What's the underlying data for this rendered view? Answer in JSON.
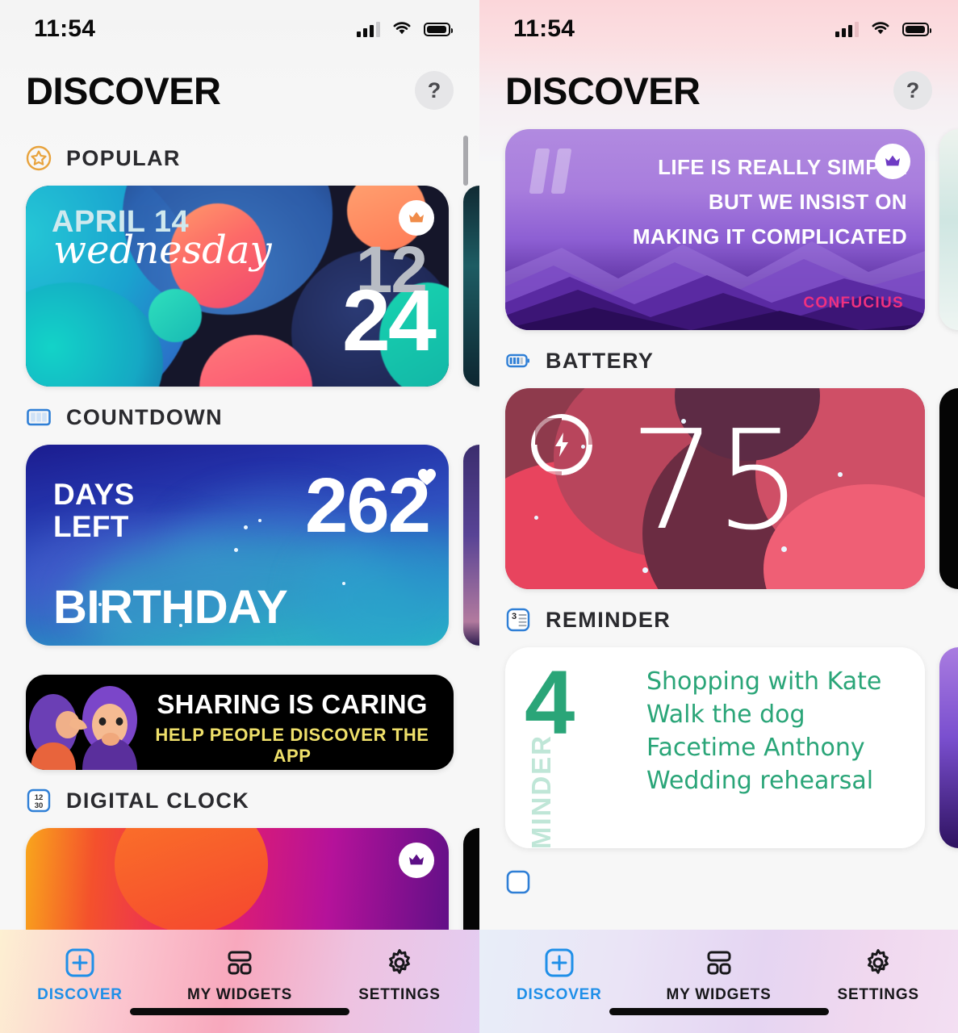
{
  "app": {
    "accent_blue": "#1f8fe8",
    "accent_orange": "#e8a33d",
    "accent_green": "#2aa578",
    "accent_pink": "#f0317f"
  },
  "panels": [
    {
      "id": "left",
      "status": {
        "time": "11:54",
        "signal_icon": "cellular-bars-icon",
        "wifi_icon": "wifi-icon",
        "battery_icon": "battery-icon"
      },
      "header": {
        "title": "DISCOVER",
        "help_label": "?"
      },
      "sections": [
        {
          "label": "POPULAR",
          "icon": "star-badge-icon",
          "widget": {
            "kind": "gradient-clock",
            "date": "APRIL 14",
            "weekday": "wednesday",
            "hour": "12",
            "minute": "24",
            "premium_badge": "crown-icon"
          }
        },
        {
          "label": "COUNTDOWN",
          "icon": "grid-columns-icon",
          "widget": {
            "kind": "countdown",
            "label_line1": "DAYS",
            "label_line2": "LEFT",
            "number": "262",
            "title": "BIRTHDAY"
          }
        }
      ],
      "promo": {
        "headline": "SHARING IS CARING",
        "subline": "HELP PEOPLE DISCOVER THE APP",
        "art": "two-women-whispering-illustration"
      },
      "trailing_section": {
        "label": "DIGITAL CLOCK",
        "icon": "clock-1230-icon"
      },
      "tabs": [
        {
          "label": "DISCOVER",
          "icon": "plus-square-icon",
          "active": true
        },
        {
          "label": "MY WIDGETS",
          "icon": "widgets-grid-icon",
          "active": false
        },
        {
          "label": "SETTINGS",
          "icon": "gear-icon",
          "active": false
        }
      ]
    },
    {
      "id": "right",
      "status": {
        "time": "11:54",
        "signal_icon": "cellular-bars-icon",
        "wifi_icon": "wifi-icon",
        "battery_icon": "battery-icon"
      },
      "header": {
        "title": "DISCOVER",
        "help_label": "?"
      },
      "sections": [
        {
          "label": "",
          "icon": "",
          "widget": {
            "kind": "quote",
            "quote_lines": [
              "LIFE IS REALLY SIMPLE",
              "BUT WE INSIST ON",
              "MAKING IT COMPLICATED"
            ],
            "author": "CONFUCIUS",
            "premium_badge": "crown-icon"
          }
        },
        {
          "label": "BATTERY",
          "icon": "battery-bars-icon",
          "widget": {
            "kind": "battery",
            "percent": "75",
            "charging_icon": "bolt-icon"
          }
        },
        {
          "label": "REMINDER",
          "icon": "reminder-list-icon",
          "widget": {
            "kind": "reminder",
            "count": "4",
            "vertical_label": "REMINDER",
            "items": [
              "Shopping with Kate",
              "Walk the dog",
              "Facetime Anthony",
              "Wedding rehearsal"
            ]
          }
        }
      ],
      "tabs": [
        {
          "label": "DISCOVER",
          "icon": "plus-square-icon",
          "active": true
        },
        {
          "label": "MY WIDGETS",
          "icon": "widgets-grid-icon",
          "active": false
        },
        {
          "label": "SETTINGS",
          "icon": "gear-icon",
          "active": false
        }
      ]
    }
  ]
}
